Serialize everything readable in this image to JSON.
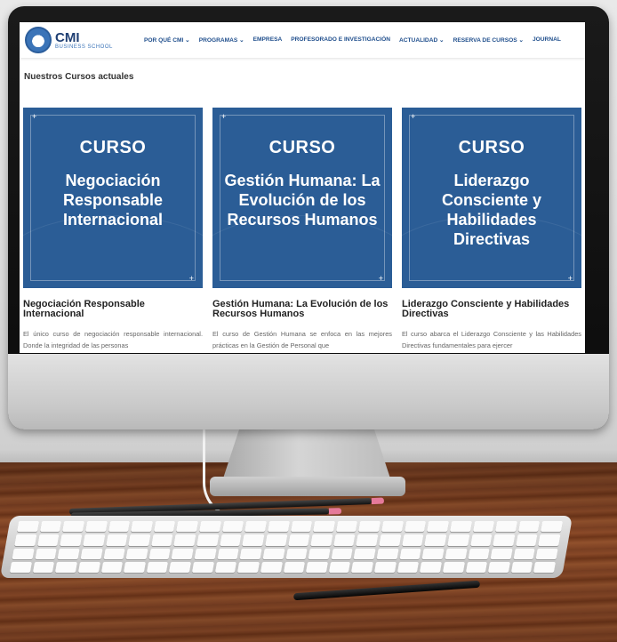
{
  "nav": {
    "logo_primary": "CMI",
    "logo_secondary": "BUSINESS SCHOOL",
    "items": [
      {
        "label": "POR QUÉ CMI ⌄"
      },
      {
        "label": "PROGRAMAS ⌄"
      },
      {
        "label": "EMPRESA"
      },
      {
        "label": "PROFESORADO E INVESTIGACIÓN"
      },
      {
        "label": "ACTUALIDAD ⌄"
      },
      {
        "label": "RESERVA DE CURSOS ⌄"
      },
      {
        "label": "JOURNAL"
      }
    ]
  },
  "page": {
    "section_title": "Nuestros Cursos actuales"
  },
  "courses": [
    {
      "image_label": "CURSO",
      "image_title": "Negociación Responsable Internacional",
      "title": "Negociación Responsable Internacional",
      "description": "El único curso de negociación responsable internacional. Donde la integridad de las personas"
    },
    {
      "image_label": "CURSO",
      "image_title": "Gestión Humana: La Evolución de los Recursos Humanos",
      "title": "Gestión Humana: La Evolución de los Recursos Humanos",
      "description": "El curso de Gestión Humana se enfoca en las mejores prácticas en la Gestión de Personal que"
    },
    {
      "image_label": "CURSO",
      "image_title": "Liderazgo Consciente y Habilidades Directivas",
      "title": "Liderazgo Consciente y Habilidades Directivas",
      "description": "El curso abarca el Liderazgo Consciente y las Habilidades Directivas fundamentales para ejercer"
    }
  ],
  "colors": {
    "brand_blue": "#2b5d96",
    "nav_text": "#1f4e8c",
    "desk_wood": "#8b4a28"
  }
}
